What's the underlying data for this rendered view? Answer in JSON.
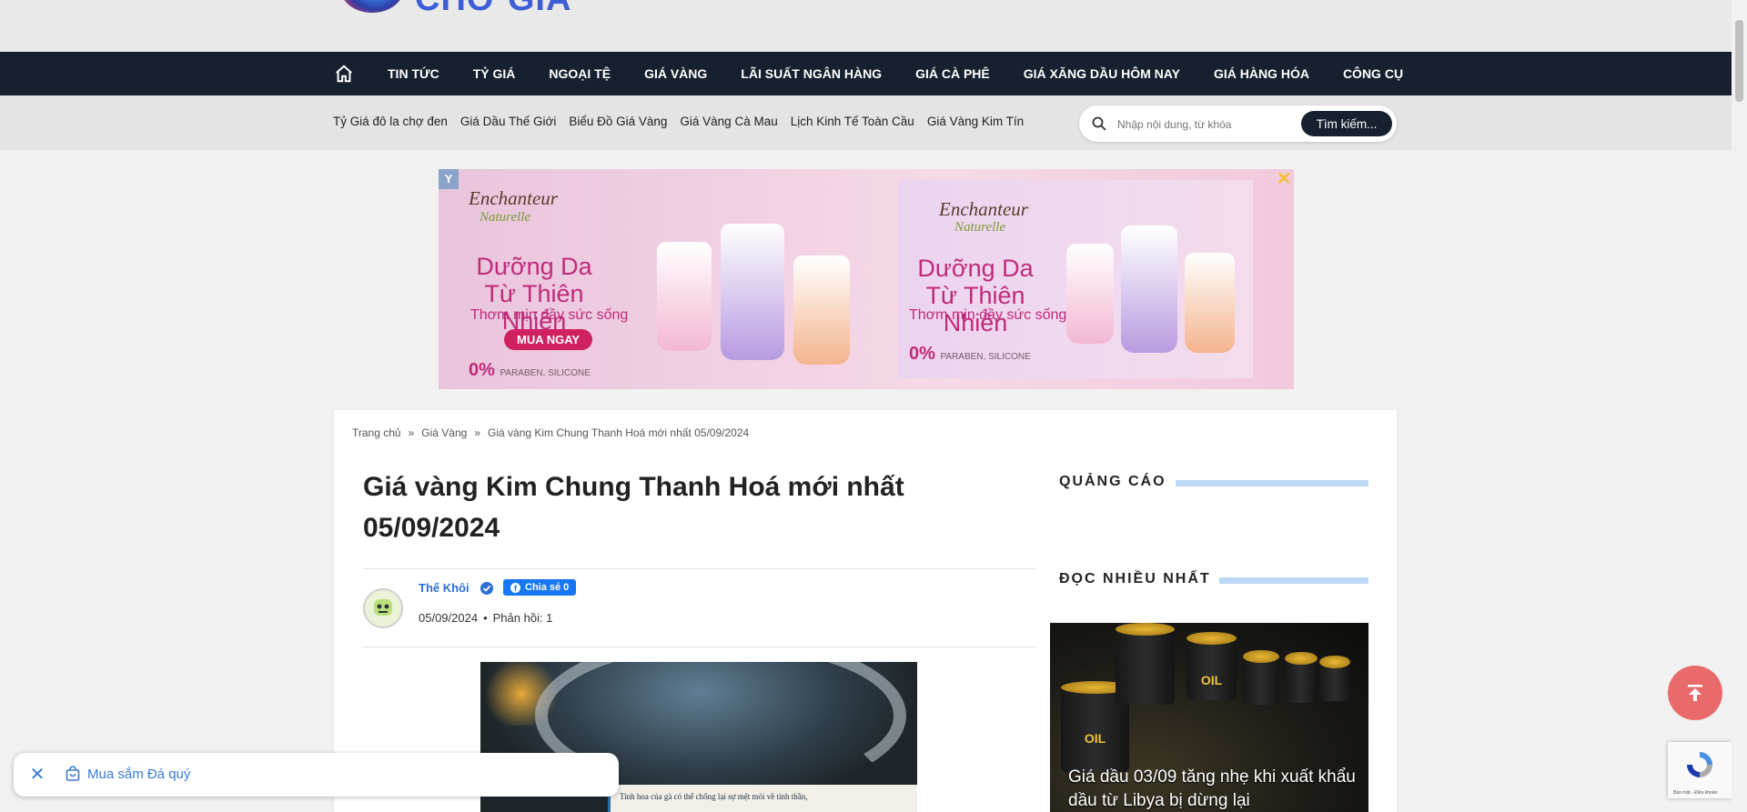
{
  "site": {
    "logo_text": "CHỢ GIÁ"
  },
  "nav": {
    "items": [
      "TIN TỨC",
      "TỶ GIÁ",
      "NGOẠI TỆ",
      "GIÁ VÀNG",
      "LÃI SUẤT NGÂN HÀNG",
      "GIÁ CÀ PHÊ",
      "GIÁ XĂNG DẦU HÔM NAY",
      "GIÁ HÀNG HÓA",
      "CÔNG CỤ"
    ]
  },
  "subnav": {
    "links": [
      "Tỷ Giá đô la chợ đen",
      "Giá Dầu Thế Giới",
      "Biểu Đồ Giá Vàng",
      "Giá Vàng Cà Mau",
      "Lịch Kinh Tế Toàn Cầu",
      "Giá Vàng Kim Tín"
    ],
    "search_placeholder": "Nhập nội dung, từ khóa",
    "search_button": "Tìm kiếm..."
  },
  "ad": {
    "badge": "Y",
    "close": "✕",
    "brand": "Enchanteur",
    "brand_sub": "Naturelle",
    "headline": "Dưỡng Da Từ Thiên Nhiên",
    "tagline": "Thơm mịn đầy sức sống",
    "cta": "MUA NGAY",
    "claim_pct": "0%",
    "claim_text": "PARABEN, SILICONE"
  },
  "breadcrumb": [
    "Trang chủ",
    "»",
    "Giá Vàng",
    "»",
    "Giá vàng Kim Chung Thanh Hoá mới nhất 05/09/2024"
  ],
  "article": {
    "title": "Giá vàng Kim Chung Thanh Hoá mới nhất 05/09/2024",
    "author": "Thế Khôi",
    "share": "Chia sẻ 0",
    "date": "05/09/2024",
    "replies": "Phản hồi: 1",
    "image_caption": "Tinh hoa của gà có thể chống lại sự mệt mỏi về tinh thần,"
  },
  "sidebar": {
    "ads_heading": "QUẢNG CÁO",
    "popular_heading": "ĐỌC NHIỀU NHẤT",
    "popular_item_title": "Giá dầu 03/09 tăng nhẹ khi xuất khẩu dầu từ Libya bị dừng lại",
    "barrel_label": "OIL"
  },
  "shopping": {
    "label": "Mua sắm Đá quý"
  },
  "recaptcha": {
    "text": "Bảo mật - Điều khoản"
  },
  "colors": {
    "nav_bg": "#16202e",
    "accent_blue": "#2c6ed5",
    "scroll_top": "#e86a6a"
  }
}
